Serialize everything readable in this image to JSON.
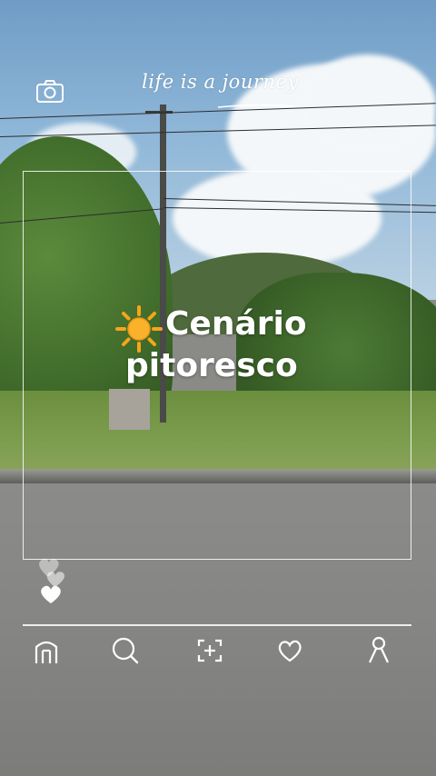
{
  "overlay": {
    "tagline": "life is a journey",
    "headline": {
      "emoji_name": "sun-emoji",
      "line1": "Cenário",
      "line2": "pitoresco"
    }
  },
  "top_bar": {
    "camera_icon": "camera-icon"
  },
  "reactions": {
    "icon": "hearts-icon"
  },
  "bottom_nav": {
    "items": [
      {
        "icon": "home-icon"
      },
      {
        "icon": "search-icon"
      },
      {
        "icon": "add-icon"
      },
      {
        "icon": "heart-icon"
      },
      {
        "icon": "profile-icon"
      }
    ]
  },
  "colors": {
    "overlay_line": "#ffffff",
    "sky": "#8fb7d8",
    "foliage": "#3f6a2a",
    "road": "#858583",
    "sun": "#f6a51b"
  }
}
